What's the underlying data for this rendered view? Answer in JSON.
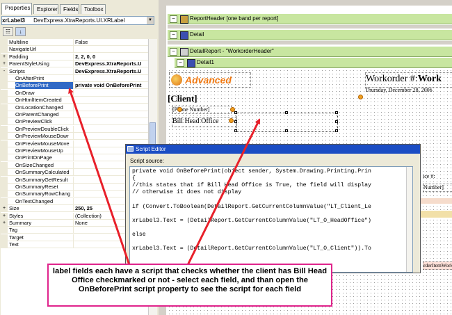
{
  "tabs": [
    "Properties",
    "Explorer",
    "Fields",
    "Toolbox"
  ],
  "selector": {
    "name": "xrLabel3",
    "type": "DevExpress.XtraReports.UI.XRLabel"
  },
  "toolbar": {
    "categorized": "categorized-icon",
    "alphabetical": "alphabetical-icon"
  },
  "properties": [
    {
      "name": "Multiline",
      "value": "False",
      "indent": 0,
      "bold": false
    },
    {
      "name": "NavigateUrl",
      "value": "",
      "indent": 0,
      "bold": false
    },
    {
      "name": "Padding",
      "value": "2, 2, 0, 0",
      "indent": 0,
      "bold": true,
      "expander": "+"
    },
    {
      "name": "ParentStyleUsing",
      "value": "DevExpress.XtraReports.U",
      "indent": 0,
      "bold": true,
      "expander": "+"
    },
    {
      "name": "Scripts",
      "value": "DevExpress.XtraReports.U",
      "indent": 0,
      "bold": true,
      "expander": "-"
    },
    {
      "name": "OnAfterPrint",
      "value": "",
      "indent": 1,
      "bold": false
    },
    {
      "name": "OnBeforePrint",
      "value": "private void OnBeforePrint",
      "indent": 1,
      "bold": true,
      "selected": true
    },
    {
      "name": "OnDraw",
      "value": "",
      "indent": 1,
      "bold": false
    },
    {
      "name": "OnHtmlItemCreated",
      "value": "",
      "indent": 1,
      "bold": false
    },
    {
      "name": "OnLocationChanged",
      "value": "",
      "indent": 1,
      "bold": false
    },
    {
      "name": "OnParentChanged",
      "value": "",
      "indent": 1,
      "bold": false
    },
    {
      "name": "OnPreviewClick",
      "value": "",
      "indent": 1,
      "bold": false
    },
    {
      "name": "OnPreviewDoubleClick",
      "value": "",
      "indent": 1,
      "bold": false
    },
    {
      "name": "OnPreviewMouseDowr",
      "value": "",
      "indent": 1,
      "bold": false
    },
    {
      "name": "OnPreviewMouseMove",
      "value": "",
      "indent": 1,
      "bold": false
    },
    {
      "name": "OnPreviewMouseUp",
      "value": "",
      "indent": 1,
      "bold": false
    },
    {
      "name": "OnPrintOnPage",
      "value": "",
      "indent": 1,
      "bold": false
    },
    {
      "name": "OnSizeChanged",
      "value": "",
      "indent": 1,
      "bold": false
    },
    {
      "name": "OnSummaryCalculated",
      "value": "",
      "indent": 1,
      "bold": false
    },
    {
      "name": "OnSummaryGetResult",
      "value": "",
      "indent": 1,
      "bold": false
    },
    {
      "name": "OnSummaryReset",
      "value": "",
      "indent": 1,
      "bold": false
    },
    {
      "name": "OnSummaryRowChang",
      "value": "",
      "indent": 1,
      "bold": false
    },
    {
      "name": "OnTextChanged",
      "value": "",
      "indent": 1,
      "bold": false
    },
    {
      "name": "Size",
      "value": "250, 25",
      "indent": 0,
      "bold": true,
      "expander": "+"
    },
    {
      "name": "Styles",
      "value": "(Collection)",
      "indent": 0,
      "bold": false,
      "expander": "+"
    },
    {
      "name": "Summary",
      "value": "None",
      "indent": 0,
      "bold": false,
      "expander": "+"
    },
    {
      "name": "Tag",
      "value": "",
      "indent": 0,
      "bold": false
    },
    {
      "name": "Target",
      "value": "",
      "indent": 0,
      "bold": false
    },
    {
      "name": "Text",
      "value": "",
      "indent": 0,
      "bold": false
    }
  ],
  "bands": {
    "report_header": "ReportHeader [one band per report]",
    "detail": "Detail",
    "detail_report": "DetailReport - \"WorkorderHeader\"",
    "detail1": "Detail1"
  },
  "report": {
    "logo_text": "Advanced",
    "workorder_label": "Workorder #:",
    "workorder_value": "Work",
    "date": "Thursday, December 28, 2006",
    "client": "[Client]",
    "phone": "[Phone Number]",
    "bill_head_office": "Bill Head Office",
    "right_frag1": "ice #:",
    "right_frag2": "Number]",
    "right_frag3": "rderItemWork"
  },
  "script_editor": {
    "title": "Script Editor",
    "source_label": "Script source:",
    "lines": [
      "private void OnBeforePrint(object sender, System.Drawing.Printing.Prin",
      "{",
      "//this states that if Bill Head Office is True, the field will display",
      "// otherwise it does not display",
      "",
      "if (Convert.ToBoolean(DetailReport.GetCurrentColumnValue(\"LT_Client_Le",
      "",
      "xrLabel3.Text = (DetailReport.GetCurrentColumnValue(\"LT_O_HeadOffice\")",
      "",
      "else",
      "",
      "xrLabel3.Text = (DetailReport.GetCurrentColumnValue(\"LT_O_Client\")).To"
    ]
  },
  "callout": {
    "text": "label fields each have a script that checks whether the client has Bill Head Office checkmarked or not - select each field, and than open the OnBeforePrint script property to see the script for each field"
  },
  "colors": {
    "callout_border": "#e0248c",
    "arrow": "#e8202a",
    "band": "#c8e6a0",
    "title_bar": "#1b4dc4",
    "selection": "#316ac5"
  }
}
